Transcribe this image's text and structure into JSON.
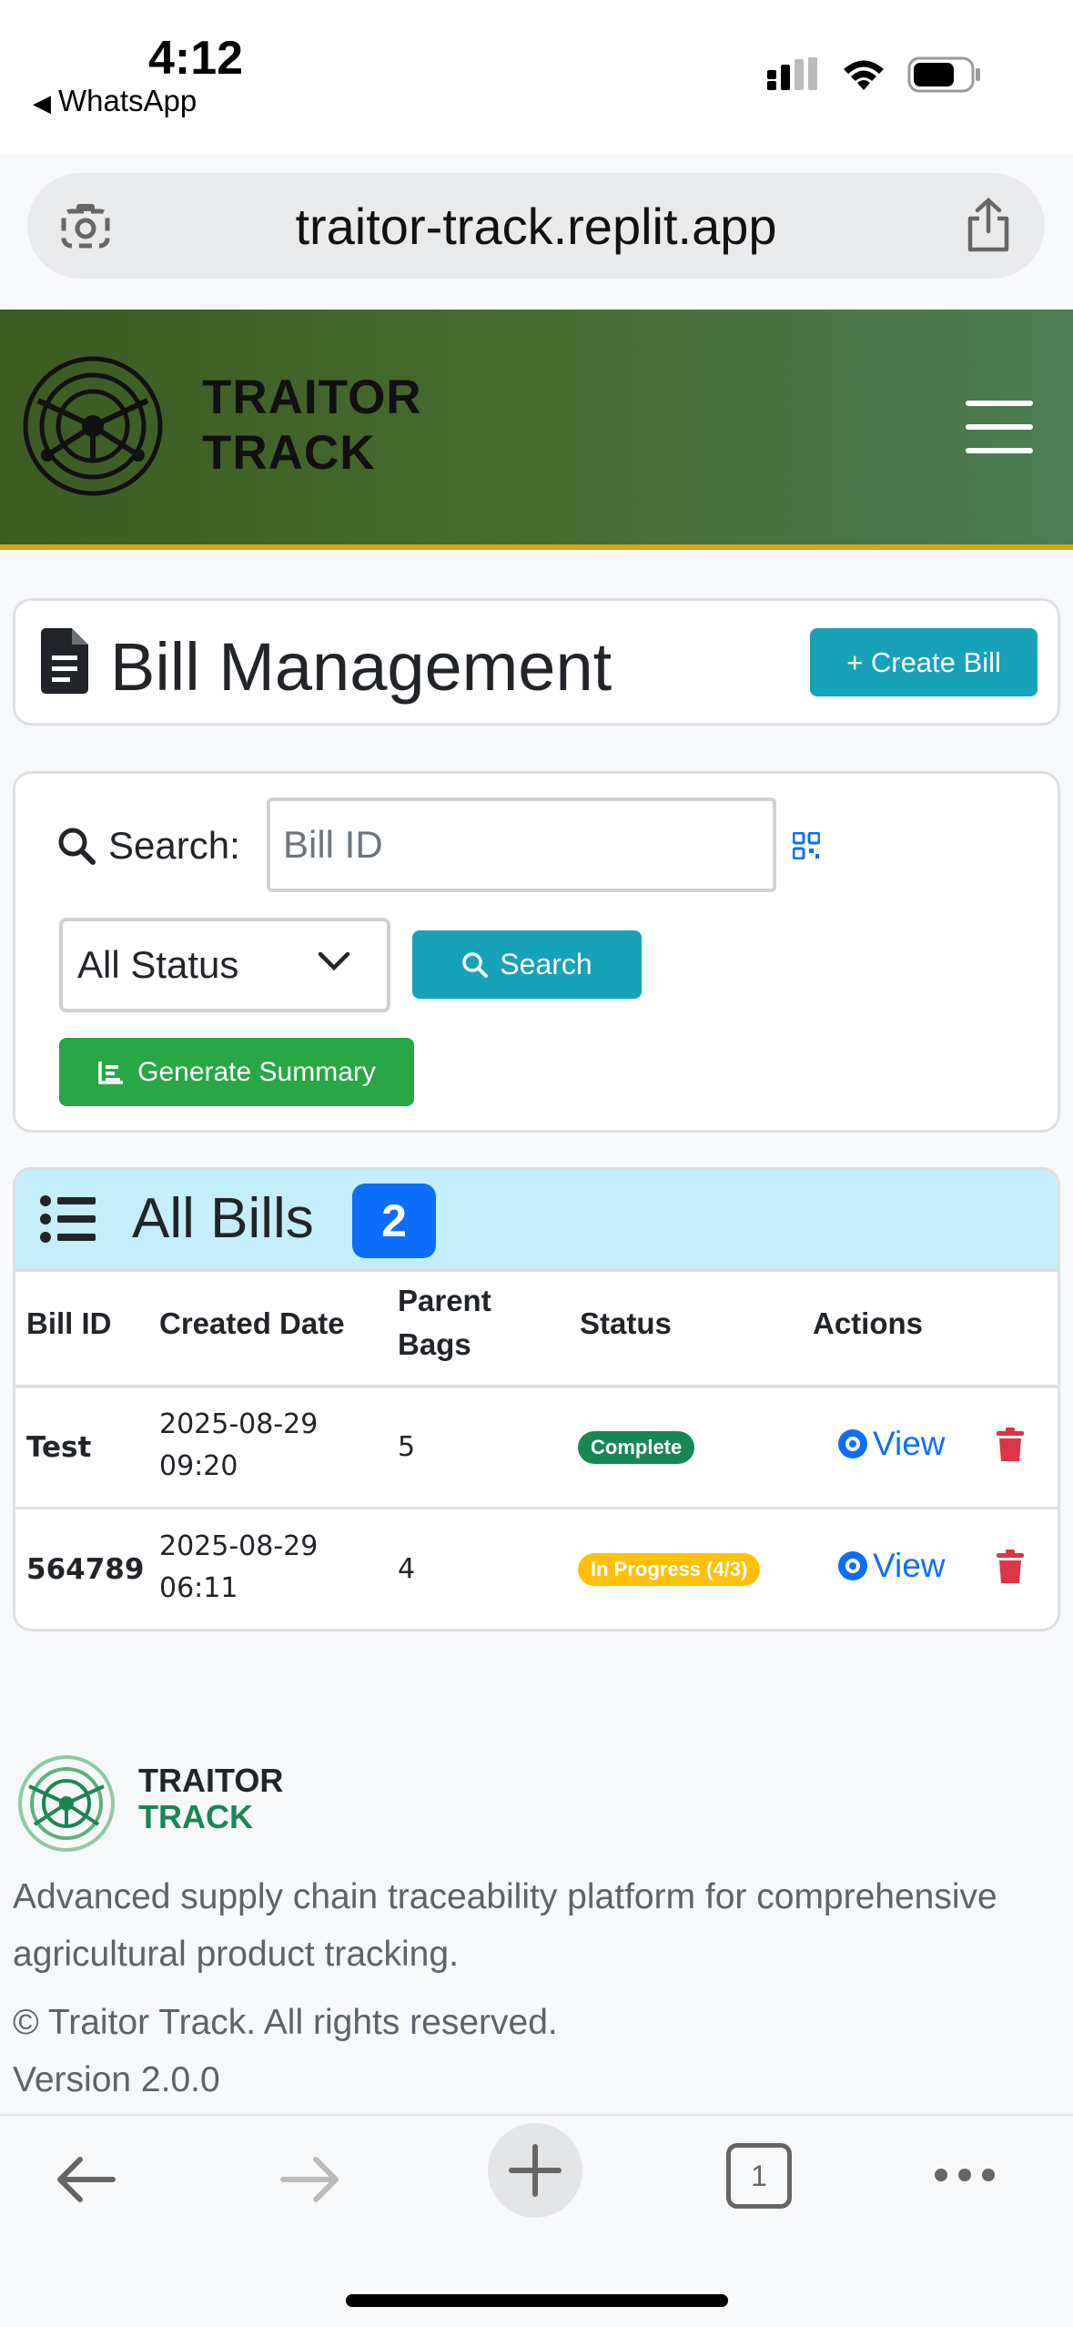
{
  "status_bar": {
    "time": "4:12",
    "back_app": "WhatsApp"
  },
  "browser": {
    "url": "traitor-track.replit.app",
    "tab_count": "1"
  },
  "header": {
    "brand_line1": "TRAITOR",
    "brand_line2": "TRACK"
  },
  "page": {
    "title": "Bill Management",
    "create_button": "+ Create Bill"
  },
  "search": {
    "label": "Search:",
    "placeholder": "Bill ID",
    "status_selected": "All Status",
    "search_button": "Search",
    "summary_button": "Generate Summary"
  },
  "bills": {
    "title": "All Bills",
    "count": "2",
    "columns": [
      "Bill ID",
      "Created Date",
      "Parent",
      "Bags",
      "Status",
      "Actions"
    ],
    "rows": [
      {
        "id": "Test",
        "date": "2025-08-29",
        "time": "09:20",
        "bags": "5",
        "status": "Complete",
        "action": "View"
      },
      {
        "id": "564789",
        "date": "2025-08-29",
        "time": "06:11",
        "bags": "4",
        "status": "In Progress (4/3)",
        "action": "View"
      }
    ]
  },
  "footer": {
    "brand_line1": "TRAITOR",
    "brand_line2": "TRACK",
    "description": "Advanced supply chain traceability platform for comprehensive agricultural product tracking.",
    "copyright": "© Traitor Track. All rights reserved.",
    "version": "Version 2.0.0"
  },
  "colors": {
    "header_start": "#3b5b21",
    "header_end": "#4a7e54",
    "accent_gold": "#d4a518",
    "info": "#17a2b8",
    "success": "#28a745",
    "primary": "#0d6efd",
    "danger": "#dc3545",
    "warning": "#ffc107"
  }
}
